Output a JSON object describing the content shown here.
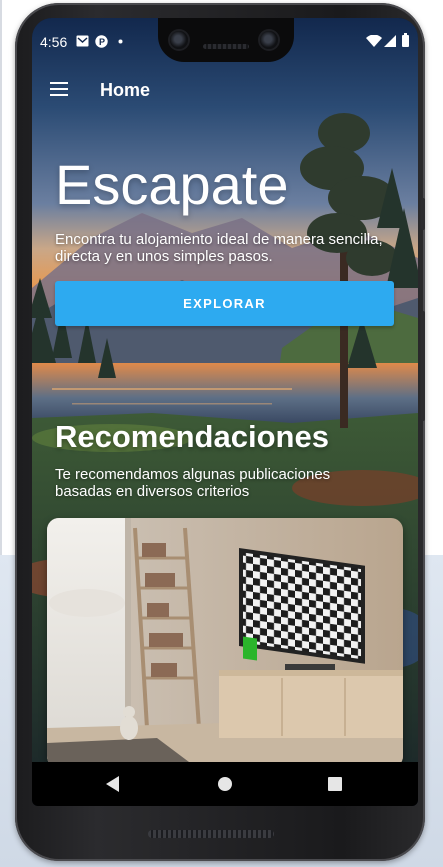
{
  "status_bar": {
    "time": "4:56"
  },
  "app_bar": {
    "title": "Home"
  },
  "hero": {
    "title": "Escapate",
    "subtitle": "Encontra tu alojamiento ideal de manera sencilla, directa y en unos simples pasos.",
    "explore_label": "EXPLORAR"
  },
  "recommendations": {
    "title": "Recomendaciones",
    "subtitle": "Te recomendamos algunas publicaciones basadas en diversos criterios"
  },
  "colors": {
    "accent": "#2daaf0"
  },
  "icons": {
    "menu": "menu-icon",
    "back": "back-triangle-icon",
    "home": "home-circle-icon",
    "recents": "recents-square-icon",
    "wifi": "wifi-icon",
    "battery": "battery-icon"
  }
}
